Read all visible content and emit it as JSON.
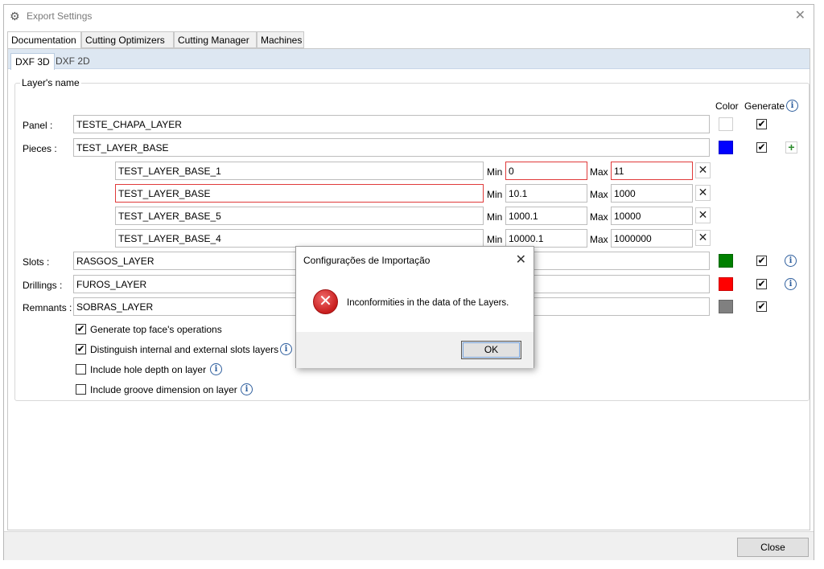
{
  "window": {
    "title": "Export Settings",
    "settings_icon": "gear-icon",
    "close_icon": "close-icon"
  },
  "tabs": [
    "Documentation",
    "Cutting Optimizers",
    "Cutting Manager",
    "Machines"
  ],
  "sub_tabs": [
    "DXF 3D",
    "DXF 2D"
  ],
  "group": {
    "legend": "Layer's name",
    "col_color": "Color",
    "col_generate": "Generate",
    "rows": [
      {
        "label": "Panel :",
        "value": "TESTE_CHAPA_LAYER",
        "color": "#ffffff",
        "generate": true
      },
      {
        "label": "Pieces :",
        "value": "TEST_LAYER_BASE",
        "color": "#0000ff",
        "generate": true
      },
      {
        "label": "Slots :",
        "value": "RASGOS_LAYER",
        "color": "#008000",
        "generate": true
      },
      {
        "label": "Drillings :",
        "value": "FUROS_LAYER",
        "color": "#ff0000",
        "generate": true
      },
      {
        "label": "Remnants :",
        "value": "SOBRAS_LAYER",
        "color": "#808080",
        "generate": true
      }
    ],
    "sublayers": [
      {
        "name": "TEST_LAYER_BASE_1",
        "min_label": "Min",
        "min": "0",
        "max_label": "Max",
        "max": "11"
      },
      {
        "name": "TEST_LAYER_BASE",
        "min_label": "Min",
        "min": "10.1",
        "max_label": "Max",
        "max": "1000"
      },
      {
        "name": "TEST_LAYER_BASE_5",
        "min_label": "Min",
        "min": "1000.1",
        "max_label": "Max",
        "max": "10000"
      },
      {
        "name": "TEST_LAYER_BASE_4",
        "min_label": "Min",
        "min": "10000.1",
        "max_label": "Max",
        "max": "1000000"
      }
    ],
    "options": [
      {
        "label": "Generate top face's operations",
        "checked": true
      },
      {
        "label": "Distinguish internal and external slots layers",
        "checked": true
      },
      {
        "label": "Include hole depth on layer",
        "checked": false
      },
      {
        "label": "Include groove dimension on layer",
        "checked": false
      }
    ]
  },
  "footer": {
    "close_label": "Close"
  },
  "dialog": {
    "title": "Configurações de Importação",
    "message": "Inconformities in the data of the Layers.",
    "ok_label": "OK",
    "error_icon": "error-icon"
  }
}
